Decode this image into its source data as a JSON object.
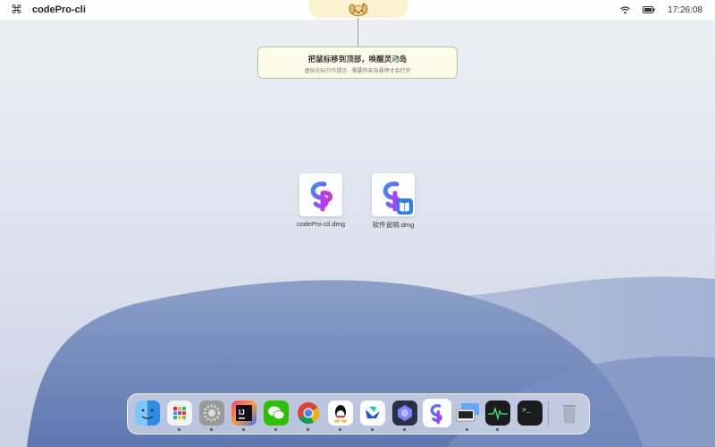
{
  "menubar": {
    "app_name": "codePro-cli",
    "clock": "17:26:08",
    "icons": [
      "command-icon",
      "wifi-icon",
      "battery-icon"
    ]
  },
  "notch": {
    "icon": "dog-mascot-icon"
  },
  "tooltip": {
    "title": "把鼠标移到顶部，唤醒灵动岛",
    "subtitle": "虚拟光标只作提示 · 需要你亲自悬停才会打开"
  },
  "desktop": {
    "files": [
      {
        "name": "codePro-cli.dmg",
        "icon": "codepro-logo-icon"
      },
      {
        "name": "软件说明.dmg",
        "icon": "codepro-logo-book-icon"
      }
    ]
  },
  "dock": {
    "apps": [
      {
        "name": "finder",
        "color": "#2d9cf0",
        "running": false
      },
      {
        "name": "launchpad",
        "color": "#ececec",
        "running": true
      },
      {
        "name": "system-settings",
        "color": "#8c8c8c",
        "running": true
      },
      {
        "name": "intellij-idea",
        "color": "#111111",
        "running": true
      },
      {
        "name": "wechat",
        "color": "#2dc100",
        "running": true
      },
      {
        "name": "chrome",
        "color": "#ffffff",
        "running": true
      },
      {
        "name": "qq",
        "color": "#ffffff",
        "running": true
      },
      {
        "name": "feishu",
        "color": "#ffffff",
        "running": true
      },
      {
        "name": "ai-assistant",
        "color": "#2a2f45",
        "running": true
      },
      {
        "name": "codepro",
        "color": "#ffffff",
        "running": true
      },
      {
        "name": "screen-mirroring",
        "color": "#5aa4ff",
        "running": true
      },
      {
        "name": "activity-monitor",
        "color": "#1c1c1c",
        "running": true
      },
      {
        "name": "terminal",
        "color": "#1c1c1c",
        "running": false
      },
      {
        "name": "trash",
        "color": "#aab0b8",
        "running": false
      }
    ]
  }
}
